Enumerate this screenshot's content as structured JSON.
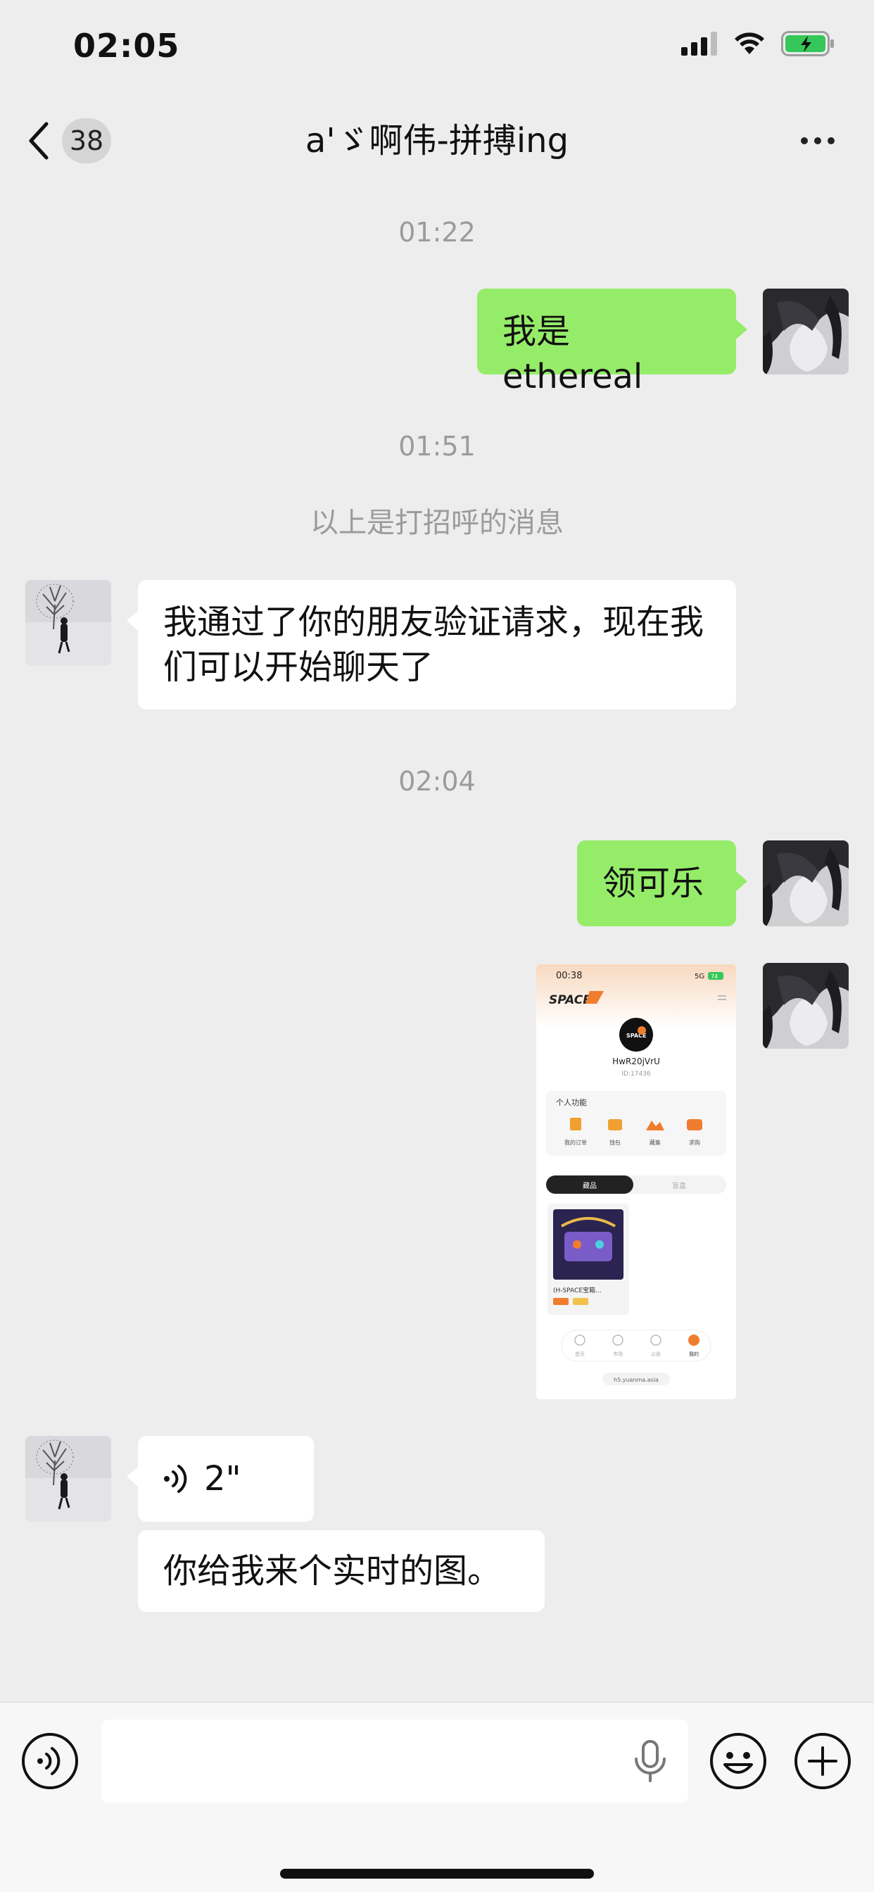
{
  "status_bar": {
    "time": "02:05"
  },
  "nav": {
    "badge_count": "38",
    "title": "a'ゞ啊伟-拼搏ing"
  },
  "messages": {
    "time_1": "01:22",
    "sent_1": "我是 ethereal",
    "time_2": "01:51",
    "system_greeting": "以上是打招呼的消息",
    "recv_1": "我通过了你的朋友验证请求，现在我们可以开始聊天了",
    "time_3": "02:04",
    "sent_2": "领可乐",
    "voice_duration": "2\"",
    "recv_2": "你给我来个实时的图。"
  },
  "screenshot_thumb": {
    "time": "00:38",
    "network": "5G",
    "battery": "74",
    "brand": "SPACE",
    "username": "HwR20jVrU",
    "user_id": "ID:17436",
    "section_title": "个人功能",
    "functions": [
      "我的订单",
      "钱包",
      "藏集",
      "求购"
    ],
    "tab_active": "藏品",
    "tab_inactive": "盲盒",
    "item_name": "(H-SPACE宝箱...",
    "nav_items": [
      "首页",
      "市场",
      "公告",
      "我的"
    ],
    "url": "h5.yuanma.asia",
    "colors": {
      "accent": "#f07c2e",
      "header_bg": "#f8d9bf"
    }
  },
  "input_bar": {
    "placeholder": ""
  },
  "colors": {
    "sent_bubble": "#95ec69",
    "recv_bubble": "#ffffff",
    "background": "#ededed",
    "timestamp": "#9b9b9b"
  }
}
